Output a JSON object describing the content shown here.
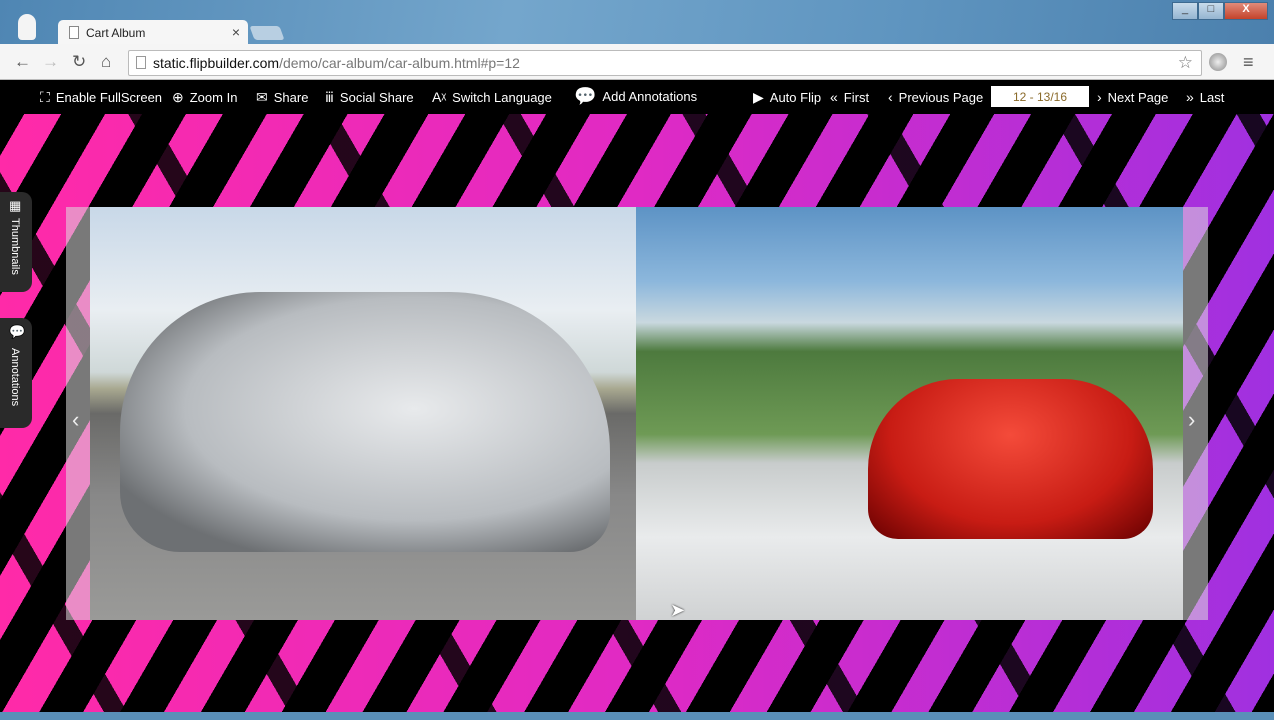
{
  "browser": {
    "tab_title": "Cart Album",
    "url_host": "static.flipbuilder.com",
    "url_path": "/demo/car-album/car-album.html#p=12"
  },
  "toolbar": {
    "fullscreen": "Enable FullScreen",
    "zoom": "Zoom In",
    "share": "Share",
    "social_share": "Social Share",
    "switch_language": "Switch Language",
    "add_annotations": "Add Annotations",
    "auto_flip": "Auto Flip",
    "first": "First",
    "previous": "Previous Page",
    "page_indicator": "12 - 13/16",
    "next": "Next Page",
    "last": "Last"
  },
  "side_tabs": {
    "thumbnails": "Thumbnails",
    "annotations": "Annotations"
  }
}
